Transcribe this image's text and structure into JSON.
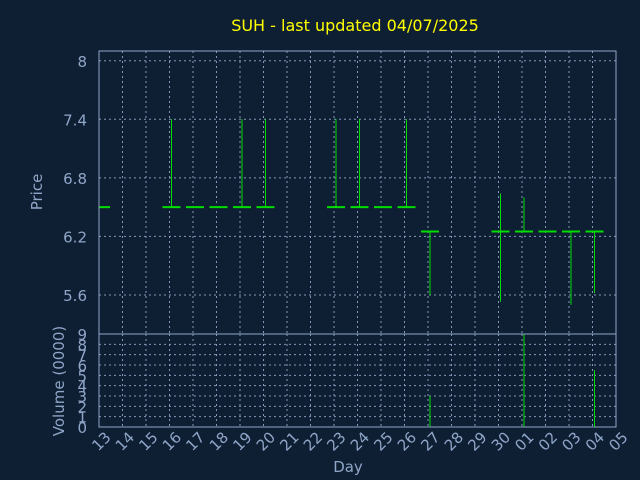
{
  "chart_data": {
    "type": "ohlc",
    "title": "SUH - last updated 04/07/2025",
    "xlabel": "Day",
    "price_panel": {
      "ylabel": "Price",
      "ylim": [
        5.2,
        8.1
      ],
      "yticks": [
        "5.6",
        "6.2",
        "6.8",
        "7.4",
        "8"
      ],
      "grid": true
    },
    "volume_panel": {
      "ylabel": "Volume (0000)",
      "ylim": [
        0,
        9
      ],
      "yticks": [
        "0",
        "1",
        "2",
        "3",
        "4",
        "5",
        "6",
        "7",
        "8",
        "9"
      ],
      "grid": true
    },
    "x_ticks": [
      "13",
      "14",
      "15",
      "16",
      "17",
      "18",
      "19",
      "20",
      "21",
      "22",
      "23",
      "24",
      "25",
      "26",
      "27",
      "28",
      "29",
      "30",
      "01",
      "02",
      "03",
      "04",
      "05"
    ],
    "bars": [
      {
        "day": "13",
        "high": 6.5,
        "low": 6.5,
        "close": 6.5,
        "volume": 0
      },
      {
        "day": "16",
        "high": 7.4,
        "low": 6.5,
        "close": 6.5,
        "volume": 0
      },
      {
        "day": "17",
        "high": 6.5,
        "low": 6.5,
        "close": 6.5,
        "volume": 0
      },
      {
        "day": "18",
        "high": 6.5,
        "low": 6.5,
        "close": 6.5,
        "volume": 0
      },
      {
        "day": "19",
        "high": 7.4,
        "low": 6.5,
        "close": 6.5,
        "volume": 0
      },
      {
        "day": "20",
        "high": 7.4,
        "low": 6.5,
        "close": 6.5,
        "volume": 0
      },
      {
        "day": "23",
        "high": 7.4,
        "low": 6.5,
        "close": 6.5,
        "volume": 0
      },
      {
        "day": "24",
        "high": 7.4,
        "low": 6.5,
        "close": 6.5,
        "volume": 0
      },
      {
        "day": "25",
        "high": 6.5,
        "low": 6.5,
        "close": 6.5,
        "volume": 0
      },
      {
        "day": "26",
        "high": 7.4,
        "low": 6.5,
        "close": 6.5,
        "volume": 0
      },
      {
        "day": "27",
        "high": 6.25,
        "low": 5.6,
        "close": 6.25,
        "volume": 3
      },
      {
        "day": "30",
        "high": 6.64,
        "low": 5.53,
        "close": 6.25,
        "volume": 0
      },
      {
        "day": "01",
        "high": 6.6,
        "low": 6.25,
        "close": 6.25,
        "volume": 9
      },
      {
        "day": "02",
        "high": 6.25,
        "low": 6.25,
        "close": 6.25,
        "volume": 0
      },
      {
        "day": "03",
        "high": 6.25,
        "low": 5.5,
        "close": 6.25,
        "volume": 0
      },
      {
        "day": "04",
        "high": 6.25,
        "low": 5.62,
        "close": 6.25,
        "volume": 5.5
      }
    ],
    "colors": {
      "background": "#0f1f33",
      "frame": "#8fa6c8",
      "grid": "#8fa6c8",
      "bar": "#00dd00",
      "title": "#ffff00",
      "text": "#8fa6c8"
    }
  }
}
